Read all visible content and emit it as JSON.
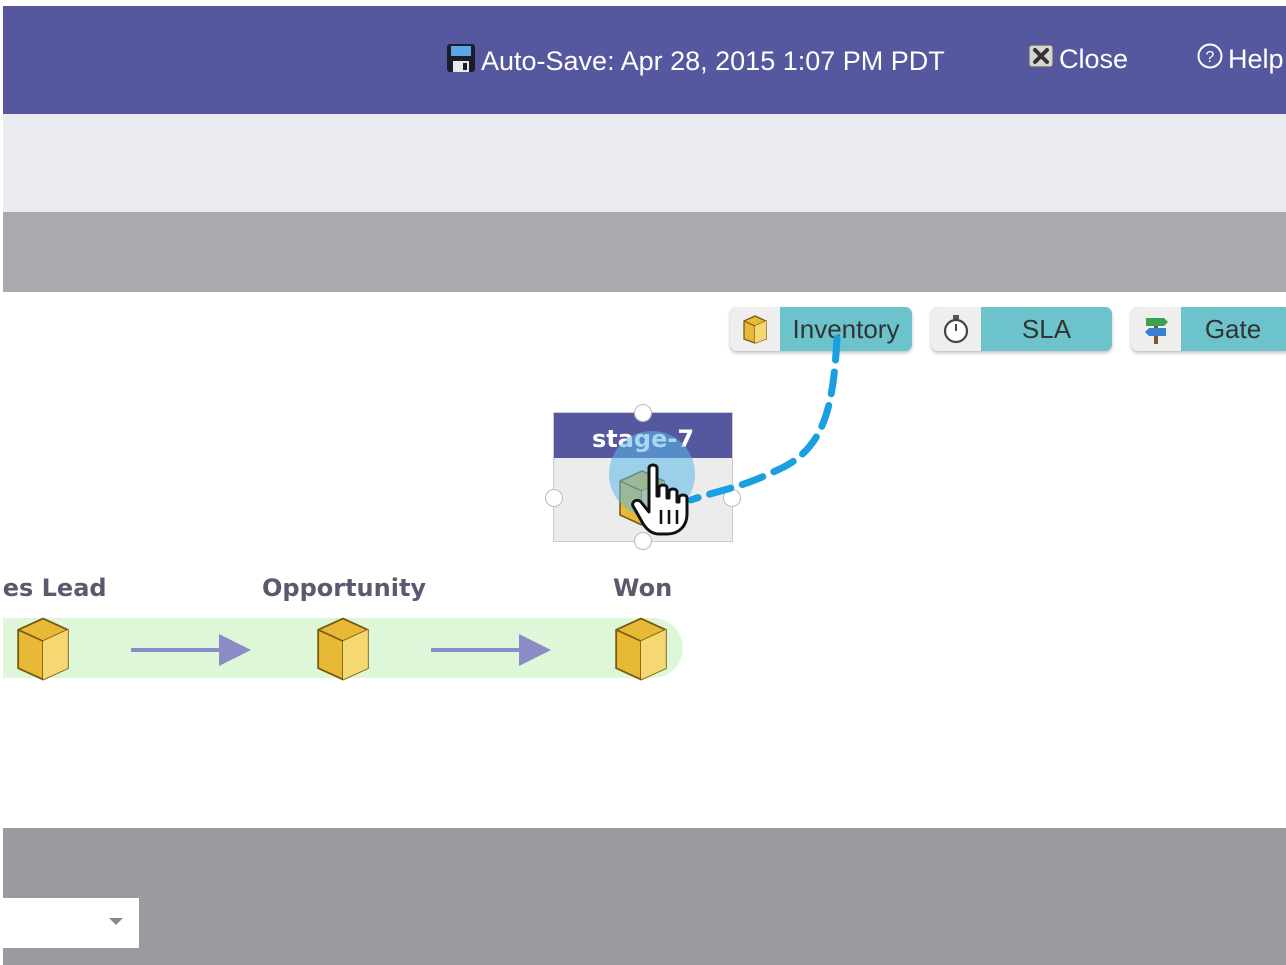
{
  "header": {
    "autosave_label": "Auto-Save: Apr 28, 2015 1:07 PM PDT",
    "close_label": "Close",
    "help_label": "Help"
  },
  "palette": {
    "items": [
      {
        "label": "Inventory",
        "icon": "box-icon"
      },
      {
        "label": "SLA",
        "icon": "stopwatch-icon"
      },
      {
        "label": "Gate",
        "icon": "signpost-icon"
      }
    ]
  },
  "canvas": {
    "new_node": {
      "title": "stage-7",
      "icon": "box-icon"
    },
    "stages": [
      {
        "label": "Sales Lead"
      },
      {
        "label": "Opportunity"
      },
      {
        "label": "Won"
      }
    ]
  },
  "colors": {
    "header_bg": "#55579f",
    "palette_accent": "#6cc3cb",
    "flow_band": "#def7d9",
    "arrow": "#8d8bc6",
    "connector": "#1a9fe0"
  },
  "bottom": {
    "select_value": ""
  }
}
